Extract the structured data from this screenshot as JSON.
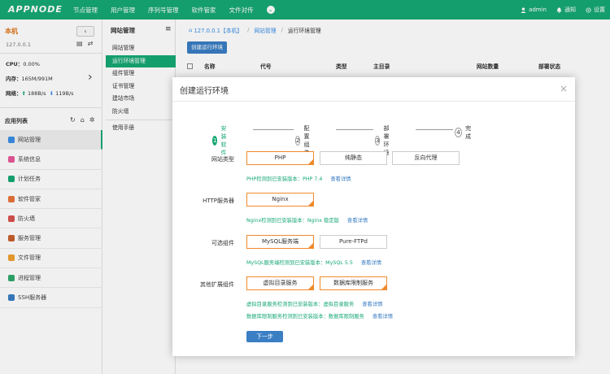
{
  "topbar": {
    "logo": "APPNODE",
    "nav": [
      "节点管理",
      "用户管理",
      "序列号管理",
      "软件管家",
      "文件对传"
    ],
    "more_icon": "chevron-down-icon",
    "user": "admin",
    "notify": "通知",
    "settings": "设置",
    "brand_color": "#17a874"
  },
  "sidebar": {
    "host": "本机",
    "collapse": "‹",
    "ip": "127.0.0.1",
    "cpu_label": "CPU：",
    "cpu_value": "0.00%",
    "mem_label": "内存：",
    "mem_value": "165M/991M",
    "net_label": "网络：",
    "net_up": "188B/s",
    "net_down": "119B/s",
    "app_list": "应用列表",
    "menu": [
      {
        "label": "网站管理",
        "color": "#3a8ee6",
        "active": true
      },
      {
        "label": "系统信息",
        "color": "#e85a9a"
      },
      {
        "label": "计划任务",
        "color": "#17a874"
      },
      {
        "label": "软件管家",
        "color": "#e8743a"
      },
      {
        "label": "防火墙",
        "color": "#d9534f"
      },
      {
        "label": "服务管理",
        "color": "#c8602c"
      },
      {
        "label": "文件管理",
        "color": "#f0a030"
      },
      {
        "label": "进程管理",
        "color": "#2fa86a"
      },
      {
        "label": "SSH服务器",
        "color": "#3a7ec4"
      }
    ]
  },
  "subnav": {
    "title": "网站管理",
    "items": [
      "网站管理",
      "运行环境管理",
      "组件管理",
      "证书管理",
      "建站市场",
      "防火墙"
    ],
    "active_index": 1,
    "manual": "使用手册"
  },
  "main": {
    "breadcrumb": [
      "127.0.0.1【本机】",
      "网站管理",
      "运行环境管理"
    ],
    "create_button": "创建运行环境",
    "columns": [
      "名称",
      "代号",
      "类型",
      "主目录",
      "网站数量",
      "部署状态"
    ]
  },
  "modal": {
    "title": "创建运行环境",
    "close": "×",
    "steps": [
      {
        "num": "1",
        "label": "安装软件",
        "active": true
      },
      {
        "num": "2",
        "label": "配置组件"
      },
      {
        "num": "3",
        "label": "部署环境"
      },
      {
        "num": "4",
        "label": "完成"
      }
    ],
    "site_type": {
      "label": "网站类型",
      "options": [
        "PHP",
        "纯静态",
        "反向代理"
      ],
      "hint": "PHP检测到已安装版本：PHP 7.4",
      "link": "查看详情"
    },
    "http": {
      "label": "HTTP服务器",
      "options": [
        "Nginx"
      ],
      "hint": "Nginx检测到已安装版本：Nginx 稳定版",
      "link": "查看详情"
    },
    "optional": {
      "label": "可选组件",
      "options": [
        "MySQL服务端",
        "Pure-FTPd"
      ],
      "hint": "MySQL服务端检测到已安装版本：MySQL 5.5",
      "link": "查看详情"
    },
    "extensions": {
      "label": "其他扩展组件",
      "options": [
        "虚拟目录服务",
        "数据库限制服务"
      ],
      "hint1": "虚拟目录服务检测到已安装版本：虚拟目录服务",
      "link1": "查看详情",
      "hint2": "数据库限制服务检测到已安装版本：数据库限制服务",
      "link2": "查看详情"
    },
    "next_button": "下一步",
    "selected_color": "#f08a2c"
  }
}
